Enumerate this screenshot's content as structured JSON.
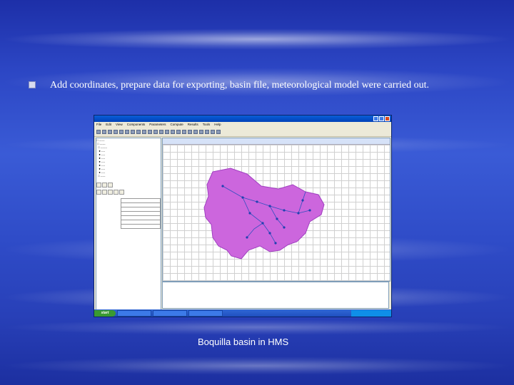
{
  "slide": {
    "bullet_text": "Add coordinates, prepare data for exporting, basin file, meteorological model were carried out.",
    "caption": "Boquilla basin in HMS"
  },
  "screenshot": {
    "menu_items": [
      "File",
      "Edit",
      "View",
      "Components",
      "Parameters",
      "Compute",
      "Results",
      "Tools",
      "Help"
    ],
    "start_label": "start",
    "colors": {
      "basin_fill": "#cc66dd",
      "basin_edge": "#a040c0",
      "reach_line": "#3050c0"
    }
  }
}
